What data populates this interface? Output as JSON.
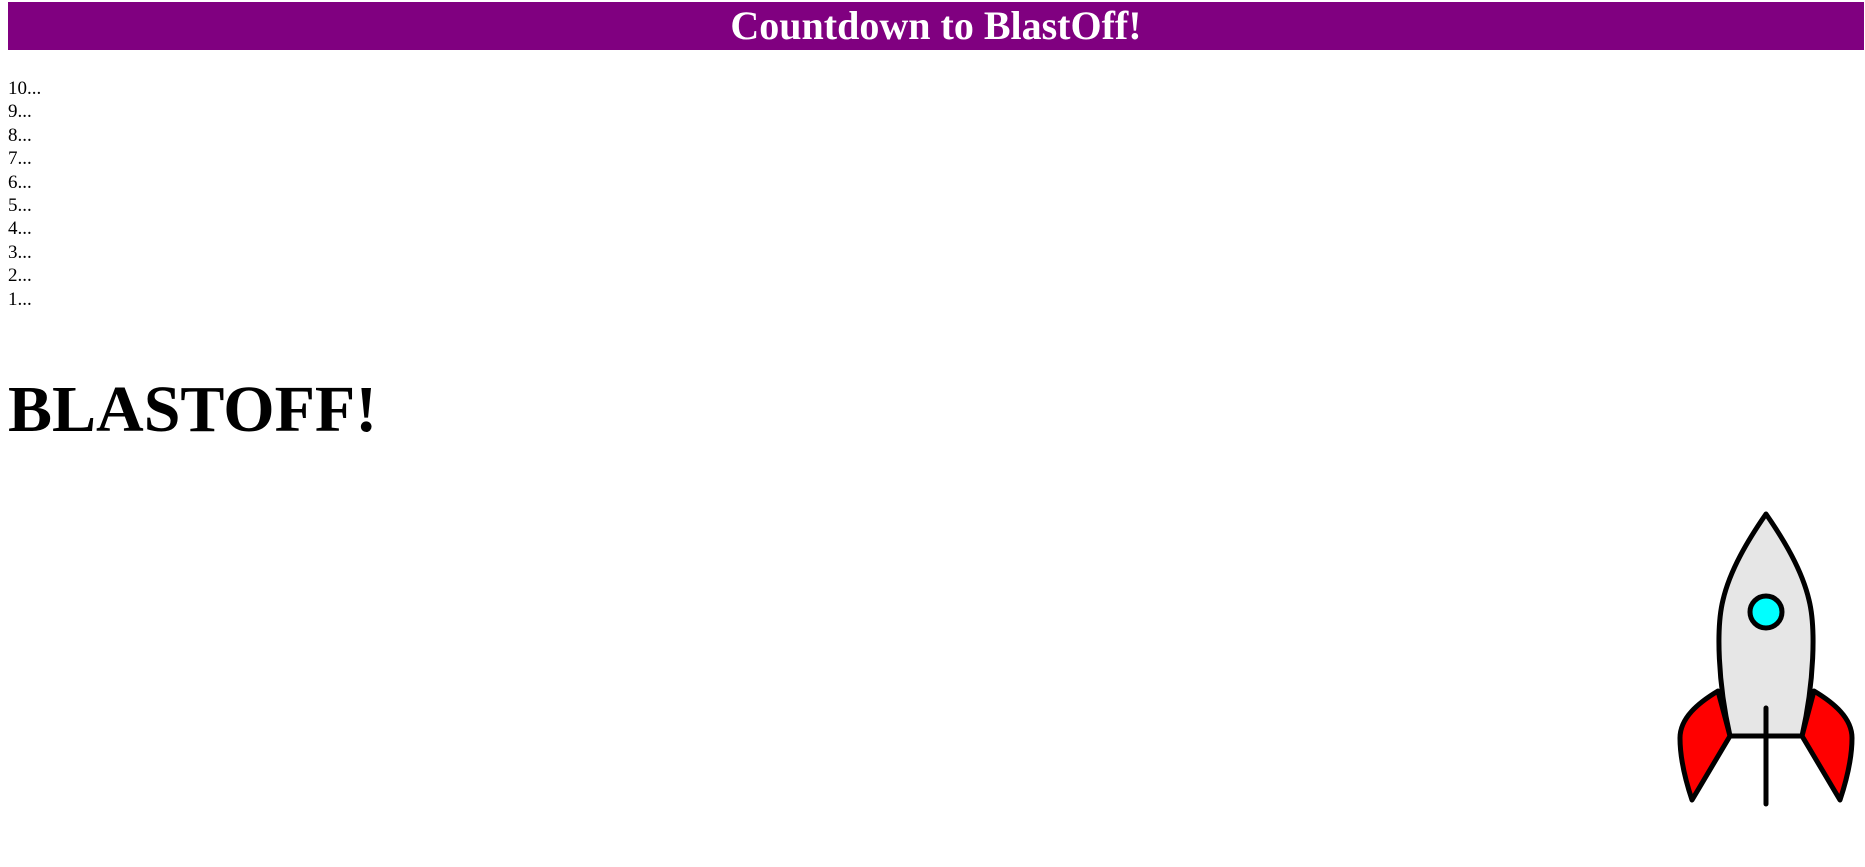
{
  "header": {
    "title": "Countdown to BlastOff!",
    "background_color": "#800080",
    "text_color": "#ffffff"
  },
  "countdown": {
    "items": [
      "10...",
      "9...",
      "8...",
      "7...",
      "6...",
      "5...",
      "4...",
      "3...",
      "2...",
      "1..."
    ]
  },
  "blastoff": {
    "text": "BLASTOFF!"
  },
  "rocket": {
    "icon": "rocket-icon",
    "body_color": "#e6e6e6",
    "fin_color": "#ff0000",
    "window_color": "#00ffff",
    "outline_color": "#000000"
  }
}
